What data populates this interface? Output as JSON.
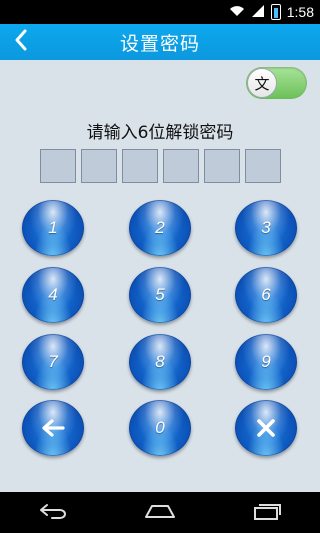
{
  "status_bar": {
    "time": "1:58"
  },
  "header": {
    "title": "设置密码"
  },
  "toggle": {
    "label": "文"
  },
  "prompt": "请输入6位解锁密码",
  "keypad": {
    "k1": "1",
    "k2": "2",
    "k3": "3",
    "k4": "4",
    "k5": "5",
    "k6": "6",
    "k7": "7",
    "k8": "8",
    "k9": "9",
    "k0": "0"
  },
  "icons": {
    "back": "chevron-left-icon",
    "backspace": "arrow-left-icon",
    "clear": "close-icon",
    "wifi": "wifi-icon",
    "signal": "signal-icon",
    "battery": "battery-icon"
  },
  "colors": {
    "header": "#0ca2e8",
    "toggle_on": "#6cc058",
    "key": "#1a6fd6"
  }
}
